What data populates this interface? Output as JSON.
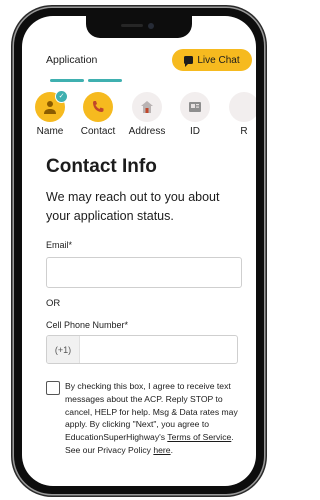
{
  "header": {
    "tab_label": "Application",
    "chat_label": "Live Chat",
    "chat_icon": "chat-bubble-icon",
    "accent_color": "#f6ba1f",
    "progress_color": "#3fb0b0"
  },
  "steps": [
    {
      "label": "Name",
      "state": "done",
      "icon": "person-icon"
    },
    {
      "label": "Contact",
      "state": "active",
      "icon": "phone-icon"
    },
    {
      "label": "Address",
      "state": "todo",
      "icon": "house-icon"
    },
    {
      "label": "ID",
      "state": "todo",
      "icon": "id-card-icon"
    },
    {
      "label": "R",
      "state": "todo",
      "icon": "step-icon"
    }
  ],
  "main": {
    "title": "Contact Info",
    "subtitle": "We may reach out to you about your application status.",
    "email_label": "Email*",
    "email_value": "",
    "or_text": "OR",
    "phone_label": "Cell Phone Number*",
    "phone_prefix": "(+1)",
    "phone_value": ""
  },
  "consent": {
    "checked": false,
    "text_1": "By checking this box, I agree to receive text messages about the ACP. Reply STOP to cancel, HELP for help. Msg & Data rates may apply. By clicking \"Next\", you agree to EducationSuperHighway's ",
    "terms_link": "Terms of Service",
    "text_2": ". See our Privacy Policy ",
    "privacy_link": "here",
    "text_3": "."
  }
}
